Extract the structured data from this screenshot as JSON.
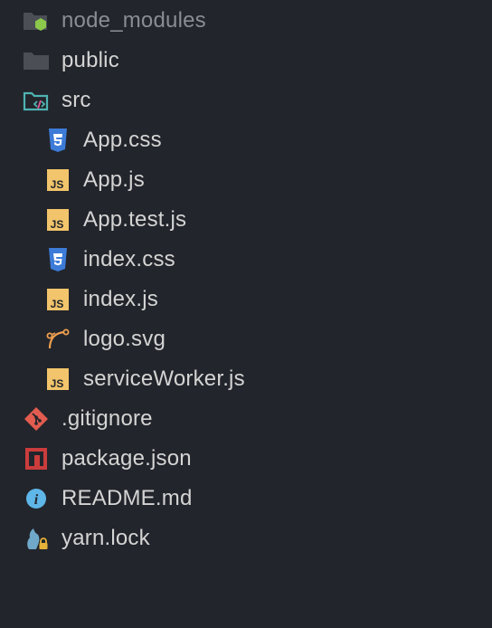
{
  "tree": {
    "items": [
      {
        "name": "node_modules",
        "icon": "nodejs-folder-icon",
        "dimmed": true
      },
      {
        "name": "public",
        "icon": "folder-icon"
      },
      {
        "name": "src",
        "icon": "source-folder-open-icon"
      },
      {
        "name": "App.css",
        "icon": "css3-icon"
      },
      {
        "name": "App.js",
        "icon": "javascript-icon"
      },
      {
        "name": "App.test.js",
        "icon": "javascript-icon"
      },
      {
        "name": "index.css",
        "icon": "css3-icon"
      },
      {
        "name": "index.js",
        "icon": "javascript-icon"
      },
      {
        "name": "logo.svg",
        "icon": "svg-curve-icon"
      },
      {
        "name": "serviceWorker.js",
        "icon": "javascript-icon"
      },
      {
        "name": ".gitignore",
        "icon": "git-icon"
      },
      {
        "name": "package.json",
        "icon": "npm-icon"
      },
      {
        "name": "README.md",
        "icon": "info-icon"
      },
      {
        "name": "yarn.lock",
        "icon": "yarn-lock-icon"
      }
    ]
  },
  "colors": {
    "background": "#22252b",
    "text": "#d4d4d4",
    "text_dim": "#8a8d93",
    "folder": "#4b4e55",
    "node_green": "#8cc84b",
    "src_teal": "#4fb3b3",
    "css_blue": "#3d7bd8",
    "js_yellow": "#f2c46b",
    "svg_orange": "#f0a050",
    "git_red": "#e25c4f",
    "npm_red": "#cb3c3c",
    "info_blue": "#5fb6e8",
    "yarn_blue": "#6fa8c8",
    "lock_yellow": "#e6b23a"
  }
}
